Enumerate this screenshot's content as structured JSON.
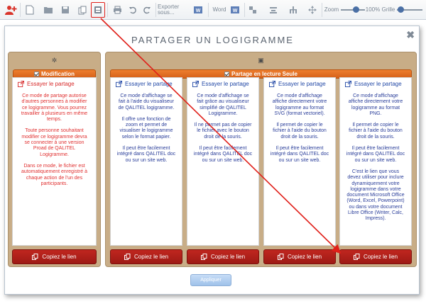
{
  "toolbar": {
    "export_label": "Exporter",
    "export_sub": "sous...",
    "word_label": "Word",
    "zoom_label": "Zoom",
    "zoom_value": "100%",
    "grid_label": "Grille",
    "zoom_level": 0.55
  },
  "dialog": {
    "title": "PARTAGER UN LOGIGRAMME",
    "apply_label": "Appliquer",
    "left_section": "Modification",
    "right_section": "Partage en lecture Seule",
    "try_label": "Essayer le partage",
    "copy_label": "Copiez le lien",
    "cards": [
      {
        "paragraphs": [
          "Ce mode de partage autorise d'autres personnes à modifier ce logigramme. Vous pourrez travailler à plusieurs en même temps.",
          "Toute personne souhaitant modifier ce logigramme devra se connecter à une version Proad de QALITEL Logigramme.",
          "Dans ce mode, le fichier est automatiquement enregistré à chaque action de l'un des participants."
        ]
      },
      {
        "paragraphs": [
          "Ce mode d'affichage se fait à l'aide du visualiseur de QALITEL logigramme.",
          "Il offre une fonction de zoom et permet de visualiser le logigramme selon le format papier.",
          "Il peut être facilement intégré dans QALITEL doc ou sur un site web."
        ]
      },
      {
        "paragraphs": [
          "Ce mode d'affichage se fait grâce au visualiseur simplifié de QALITEL Logigramme.",
          "Il ne permet pas de copier le fichier avec le bouton droit de la souris.",
          "Il peut être facilement intégré dans QALITEL doc ou sur un site web."
        ]
      },
      {
        "paragraphs": [
          "Ce mode d'affichage affiche directement votre logigramme au format SVG (format vectoriel).",
          "Il permet de copier le fichier à l'aide du bouton droit de la souris.",
          "Il peut être facilement intégré dans QALITEL doc ou sur un site web."
        ]
      },
      {
        "paragraphs": [
          "Ce mode d'affichage affiche directement votre logigramme au format PNG.",
          "Il permet de copier le fichier à l'aide du bouton droit de la souris.",
          "Il peut être facilement intégré dans QALITEL doc ou sur un site web.",
          "C'est le lien que vous devez utiliser pour inclure dynamiquement votre logigramme dans votre document Microsoft Office (Word, Excel, Powerpoint) ou dans votre document Libre Office (Writer, Calc, Impress)."
        ]
      }
    ]
  },
  "colors": {
    "accent_orange": "#e06f22",
    "copy_red": "#b0201a",
    "panel_tan": "#c8ad87",
    "annotation_red": "#e0201a"
  },
  "icons": [
    "add-user-icon",
    "new-document-icon",
    "open-folder-icon",
    "save-icon",
    "copy-icon",
    "share-icon",
    "print-icon",
    "undo-icon",
    "redo-icon",
    "export-icon",
    "word-icon",
    "word-export-icon",
    "layout-icon",
    "align-icon",
    "hierarchy-icon",
    "move-icon"
  ]
}
